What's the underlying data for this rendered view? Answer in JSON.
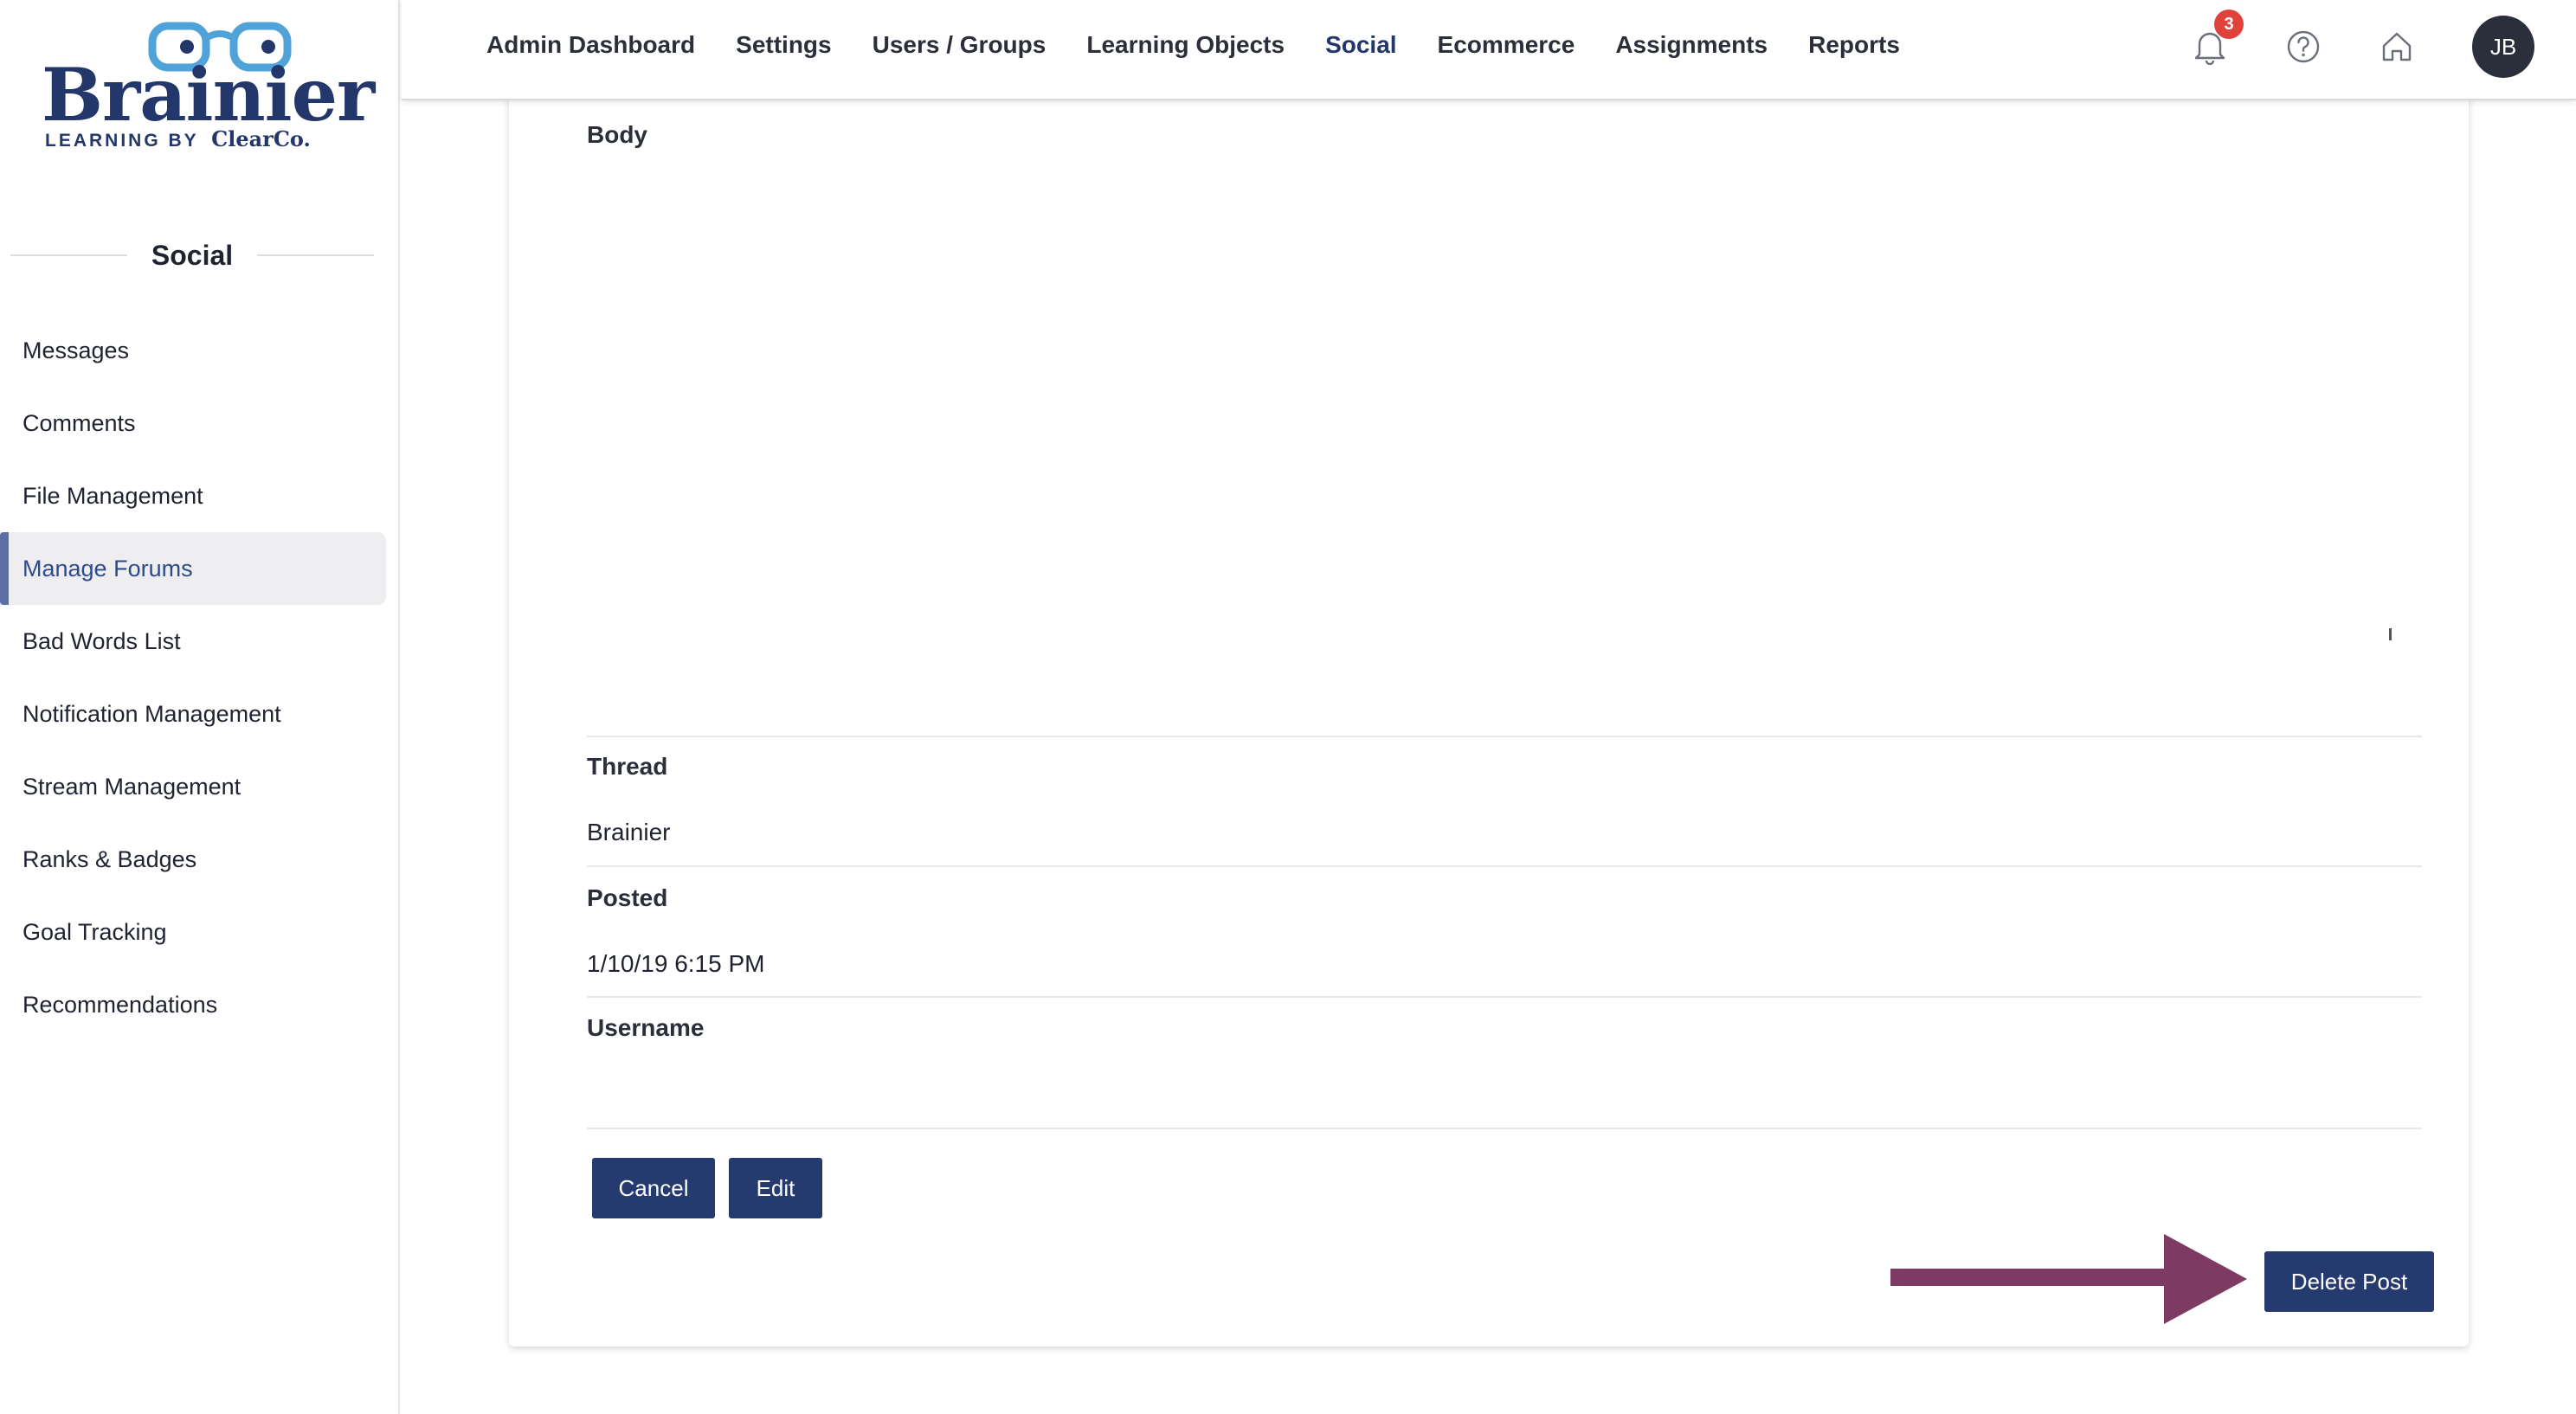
{
  "sidebar": {
    "logo": {
      "word": "Brainier",
      "tagline": "LEARNING BY",
      "brand": "ClearCo."
    },
    "section_title": "Social",
    "items": [
      {
        "label": "Messages"
      },
      {
        "label": "Comments"
      },
      {
        "label": "File Management"
      },
      {
        "label": "Manage Forums",
        "active": true
      },
      {
        "label": "Bad Words List"
      },
      {
        "label": "Notification Management"
      },
      {
        "label": "Stream Management"
      },
      {
        "label": "Ranks & Badges"
      },
      {
        "label": "Goal Tracking"
      },
      {
        "label": "Recommendations"
      }
    ]
  },
  "topnav": {
    "items": [
      {
        "label": "Admin Dashboard"
      },
      {
        "label": "Settings"
      },
      {
        "label": "Users / Groups"
      },
      {
        "label": "Learning Objects"
      },
      {
        "label": "Social",
        "active": true
      },
      {
        "label": "Ecommerce"
      },
      {
        "label": "Assignments"
      },
      {
        "label": "Reports"
      }
    ],
    "notification_count": "3",
    "avatar_initials": "JB",
    "icons": [
      "bell-icon",
      "help-icon",
      "home-icon"
    ]
  },
  "post": {
    "body_label": "Body",
    "body_value": "",
    "thread_label": "Thread",
    "thread_value": "Brainier",
    "posted_label": "Posted",
    "posted_value": "1/10/19 6:15 PM",
    "username_label": "Username",
    "username_value": ""
  },
  "actions": {
    "cancel_label": "Cancel",
    "edit_label": "Edit",
    "delete_label": "Delete Post"
  },
  "colors": {
    "primary": "#253b70",
    "active_nav": "#24376b",
    "badge": "#e0433b",
    "arrow": "#7d3a63"
  }
}
